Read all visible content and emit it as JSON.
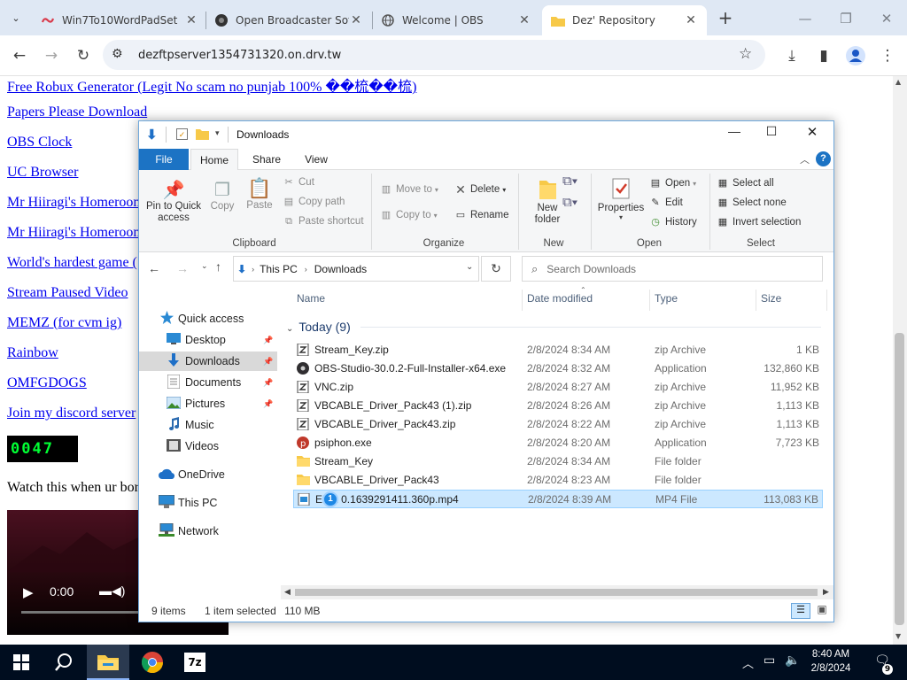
{
  "browser": {
    "tabs": [
      {
        "label": "Win7To10WordPadSet",
        "icon": "swirl-icon",
        "active": false
      },
      {
        "label": "Open Broadcaster Soft",
        "icon": "obs-icon",
        "active": false
      },
      {
        "label": "Welcome | OBS",
        "icon": "globe-icon",
        "active": false
      },
      {
        "label": "Dez' Repository",
        "icon": "folder-icon",
        "active": true
      }
    ],
    "new_tab": "+",
    "url": "dezftpserver1354731320.on.drv.tw"
  },
  "page": {
    "links": [
      "Free Robux Generator (Legit No scam no punjab 100% ��梳��梳)",
      "Papers Please Download",
      "OBS Clock",
      "UC Browser",
      "Mr Hiiragi's Homeroom",
      "Mr Hiiragi's Homeroom",
      "World's hardest game (",
      "Stream Paused Video",
      "MEMZ (for cvm ig)",
      "Rainbow",
      "OMFGDOGS",
      "Join my discord server"
    ],
    "counter": "0047",
    "watch_text": "Watch this when ur bor",
    "video_time": "0:00"
  },
  "explorer": {
    "title": "Downloads",
    "ribbon_tabs": [
      "File",
      "Home",
      "Share",
      "View"
    ],
    "clipboard": {
      "pin": "Pin to Quick access",
      "copy": "Copy",
      "paste": "Paste",
      "cut": "Cut",
      "copy_path": "Copy path",
      "paste_shortcut": "Paste shortcut",
      "group": "Clipboard"
    },
    "organize": {
      "move_to": "Move to",
      "copy_to": "Copy to",
      "delete": "Delete",
      "rename": "Rename",
      "group": "Organize"
    },
    "new": {
      "new_folder": "New folder",
      "group": "New"
    },
    "open": {
      "properties": "Properties",
      "open": "Open",
      "edit": "Edit",
      "history": "History",
      "group": "Open"
    },
    "select": {
      "select_all": "Select all",
      "select_none": "Select none",
      "invert": "Invert selection",
      "group": "Select"
    },
    "address": {
      "root": "This PC",
      "current": "Downloads"
    },
    "search_placeholder": "Search Downloads",
    "nav": [
      {
        "label": "Quick access",
        "icon": "star-icon",
        "pinned": false
      },
      {
        "label": "Desktop",
        "icon": "desktop-icon",
        "pinned": true
      },
      {
        "label": "Downloads",
        "icon": "download-icon",
        "pinned": true
      },
      {
        "label": "Documents",
        "icon": "documents-icon",
        "pinned": true
      },
      {
        "label": "Pictures",
        "icon": "pictures-icon",
        "pinned": true
      },
      {
        "label": "Music",
        "icon": "music-icon",
        "pinned": false
      },
      {
        "label": "Videos",
        "icon": "videos-icon",
        "pinned": false
      },
      {
        "label": "OneDrive",
        "icon": "cloud-icon",
        "pinned": false
      },
      {
        "label": "This PC",
        "icon": "pc-icon",
        "pinned": false
      },
      {
        "label": "Network",
        "icon": "network-icon",
        "pinned": false
      }
    ],
    "columns": [
      "Name",
      "Date modified",
      "Type",
      "Size"
    ],
    "group_label": "Today (9)",
    "files": [
      {
        "name": "Stream_Key.zip",
        "date": "2/8/2024 8:34 AM",
        "type": "zip Archive",
        "size": "1 KB",
        "icon": "zip",
        "selected": false
      },
      {
        "name": "OBS-Studio-30.0.2-Full-Installer-x64.exe",
        "date": "2/8/2024 8:32 AM",
        "type": "Application",
        "size": "132,860 KB",
        "icon": "obs",
        "selected": false
      },
      {
        "name": "VNC.zip",
        "date": "2/8/2024 8:27 AM",
        "type": "zip Archive",
        "size": "11,952 KB",
        "icon": "zip",
        "selected": false
      },
      {
        "name": "VBCABLE_Driver_Pack43 (1).zip",
        "date": "2/8/2024 8:26 AM",
        "type": "zip Archive",
        "size": "1,113 KB",
        "icon": "zip",
        "selected": false
      },
      {
        "name": "VBCABLE_Driver_Pack43.zip",
        "date": "2/8/2024 8:22 AM",
        "type": "zip Archive",
        "size": "1,113 KB",
        "icon": "zip",
        "selected": false
      },
      {
        "name": "psiphon.exe",
        "date": "2/8/2024 8:20 AM",
        "type": "Application",
        "size": "7,723 KB",
        "icon": "psiphon",
        "selected": false
      },
      {
        "name": "Stream_Key",
        "date": "2/8/2024 8:34 AM",
        "type": "File folder",
        "size": "",
        "icon": "folder",
        "selected": false
      },
      {
        "name": "VBCABLE_Driver_Pack43",
        "date": "2/8/2024 8:23 AM",
        "type": "File folder",
        "size": "",
        "icon": "folder",
        "selected": false
      },
      {
        "name": "EP 1 0.1639291411.360p.mp4",
        "date": "2/8/2024 8:39 AM",
        "type": "MP4 File",
        "size": "113,083 KB",
        "icon": "video",
        "selected": true
      }
    ],
    "status": {
      "count": "9 items",
      "selected": "1 item selected",
      "size": "110 MB"
    }
  },
  "taskbar": {
    "time": "8:40 AM",
    "date": "2/8/2024",
    "notifications": "9"
  },
  "colors": {
    "accent": "#0063b1",
    "selection": "#cce8ff",
    "taskbar": "#000d1f"
  }
}
